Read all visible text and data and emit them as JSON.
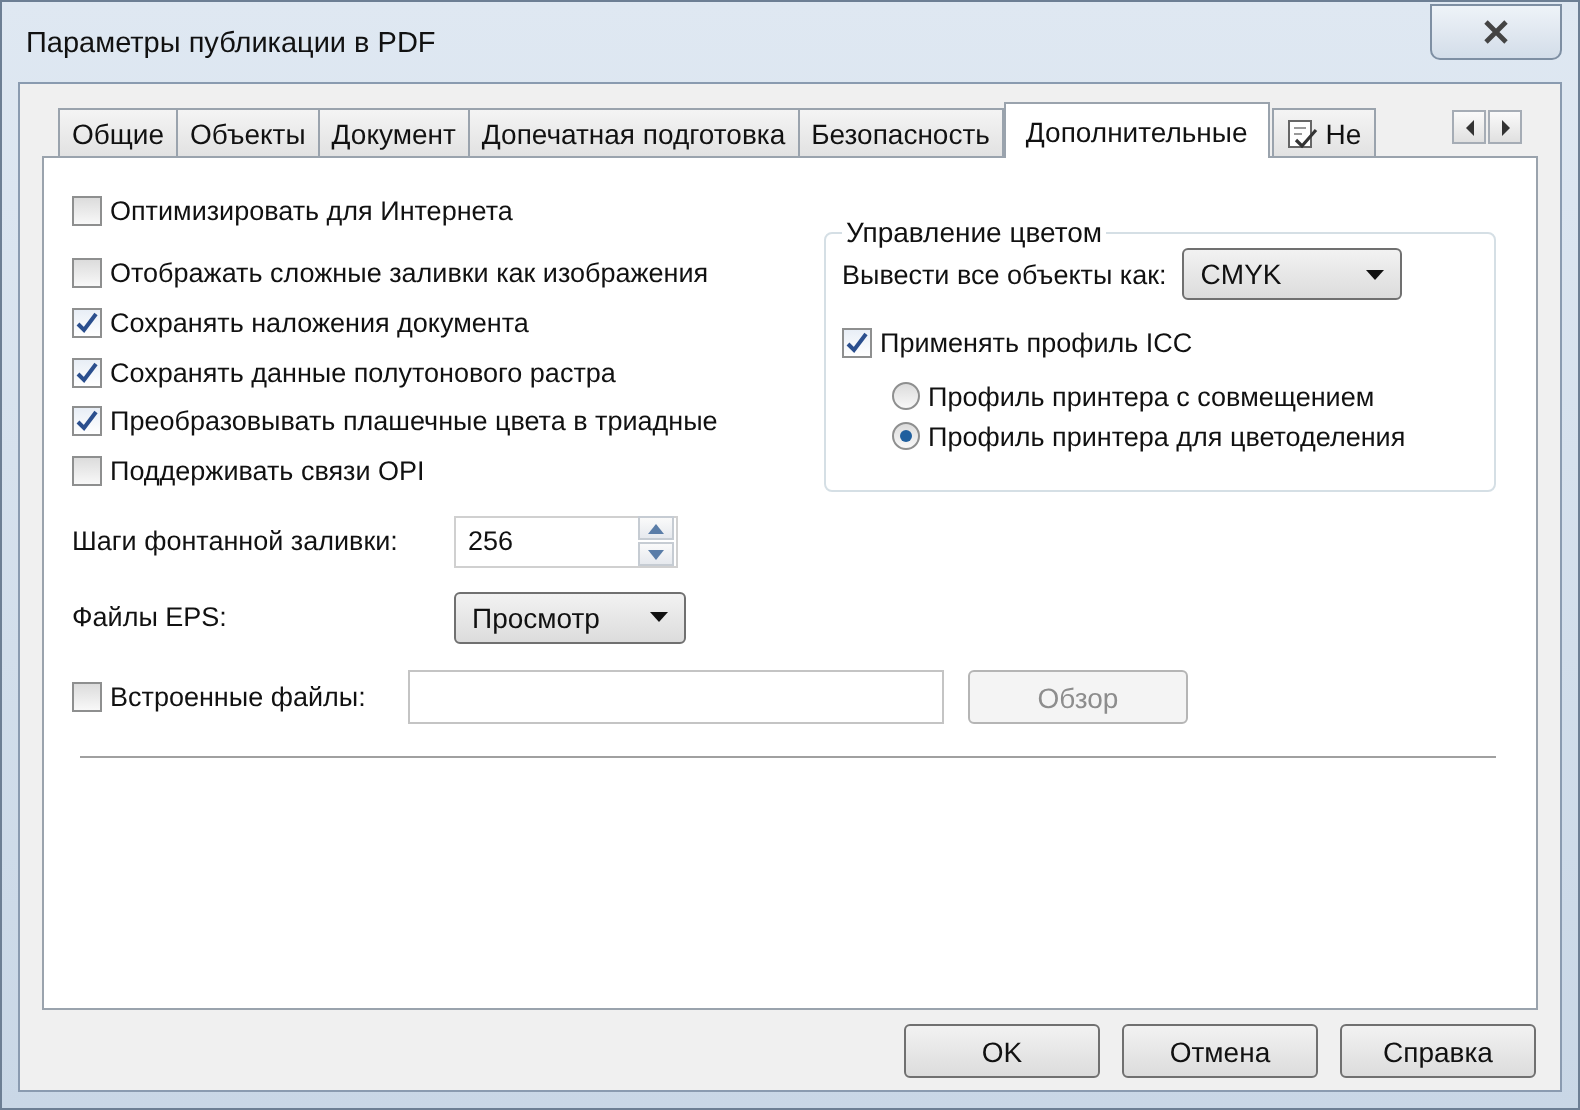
{
  "window": {
    "title": "Параметры публикации в PDF"
  },
  "tabs": [
    {
      "label": "Общие",
      "selected": false,
      "kind": "plain"
    },
    {
      "label": "Объекты",
      "selected": false,
      "kind": "plain"
    },
    {
      "label": "Документ",
      "selected": false,
      "kind": "plain"
    },
    {
      "label": "Допечатная подготовка",
      "selected": false,
      "kind": "plain"
    },
    {
      "label": "Безопасность",
      "selected": false,
      "kind": "plain"
    },
    {
      "label": "Дополнительные",
      "selected": true,
      "kind": "plain"
    },
    {
      "label": "Не",
      "selected": false,
      "kind": "icon"
    }
  ],
  "optimize": {
    "label": "Оптимизировать для Интернета",
    "checked": false
  },
  "checkboxes": [
    {
      "label": "Отображать сложные заливки как изображения",
      "checked": false
    },
    {
      "label": "Сохранять наложения документа",
      "checked": true
    },
    {
      "label": "Сохранять данные полутонового растра",
      "checked": true
    },
    {
      "label": "Преобразовывать плашечные цвета в триадные",
      "checked": true
    },
    {
      "label": "Поддерживать связи OPI",
      "checked": false
    }
  ],
  "fountain_steps": {
    "label": "Шаги фонтанной заливки:",
    "value": "256"
  },
  "eps_files": {
    "label": "Файлы EPS:",
    "value": "Просмотр"
  },
  "embedded_files": {
    "label": "Встроенные файлы:",
    "checked": false,
    "browse_button": {
      "label": "Обзор",
      "disabled": true
    }
  },
  "color_management": {
    "title": "Управление цветом",
    "output_label": "Вывести все объекты как:",
    "output_value": "CMYK",
    "icc": {
      "label": "Применять профиль ICC",
      "checked": true
    },
    "profiles": [
      {
        "label": "Профиль принтера с совмещением",
        "selected": false
      },
      {
        "label": "Профиль принтера для цветоделения",
        "selected": true
      }
    ]
  },
  "buttons": [
    "OK",
    "Отмена",
    "Справка"
  ]
}
